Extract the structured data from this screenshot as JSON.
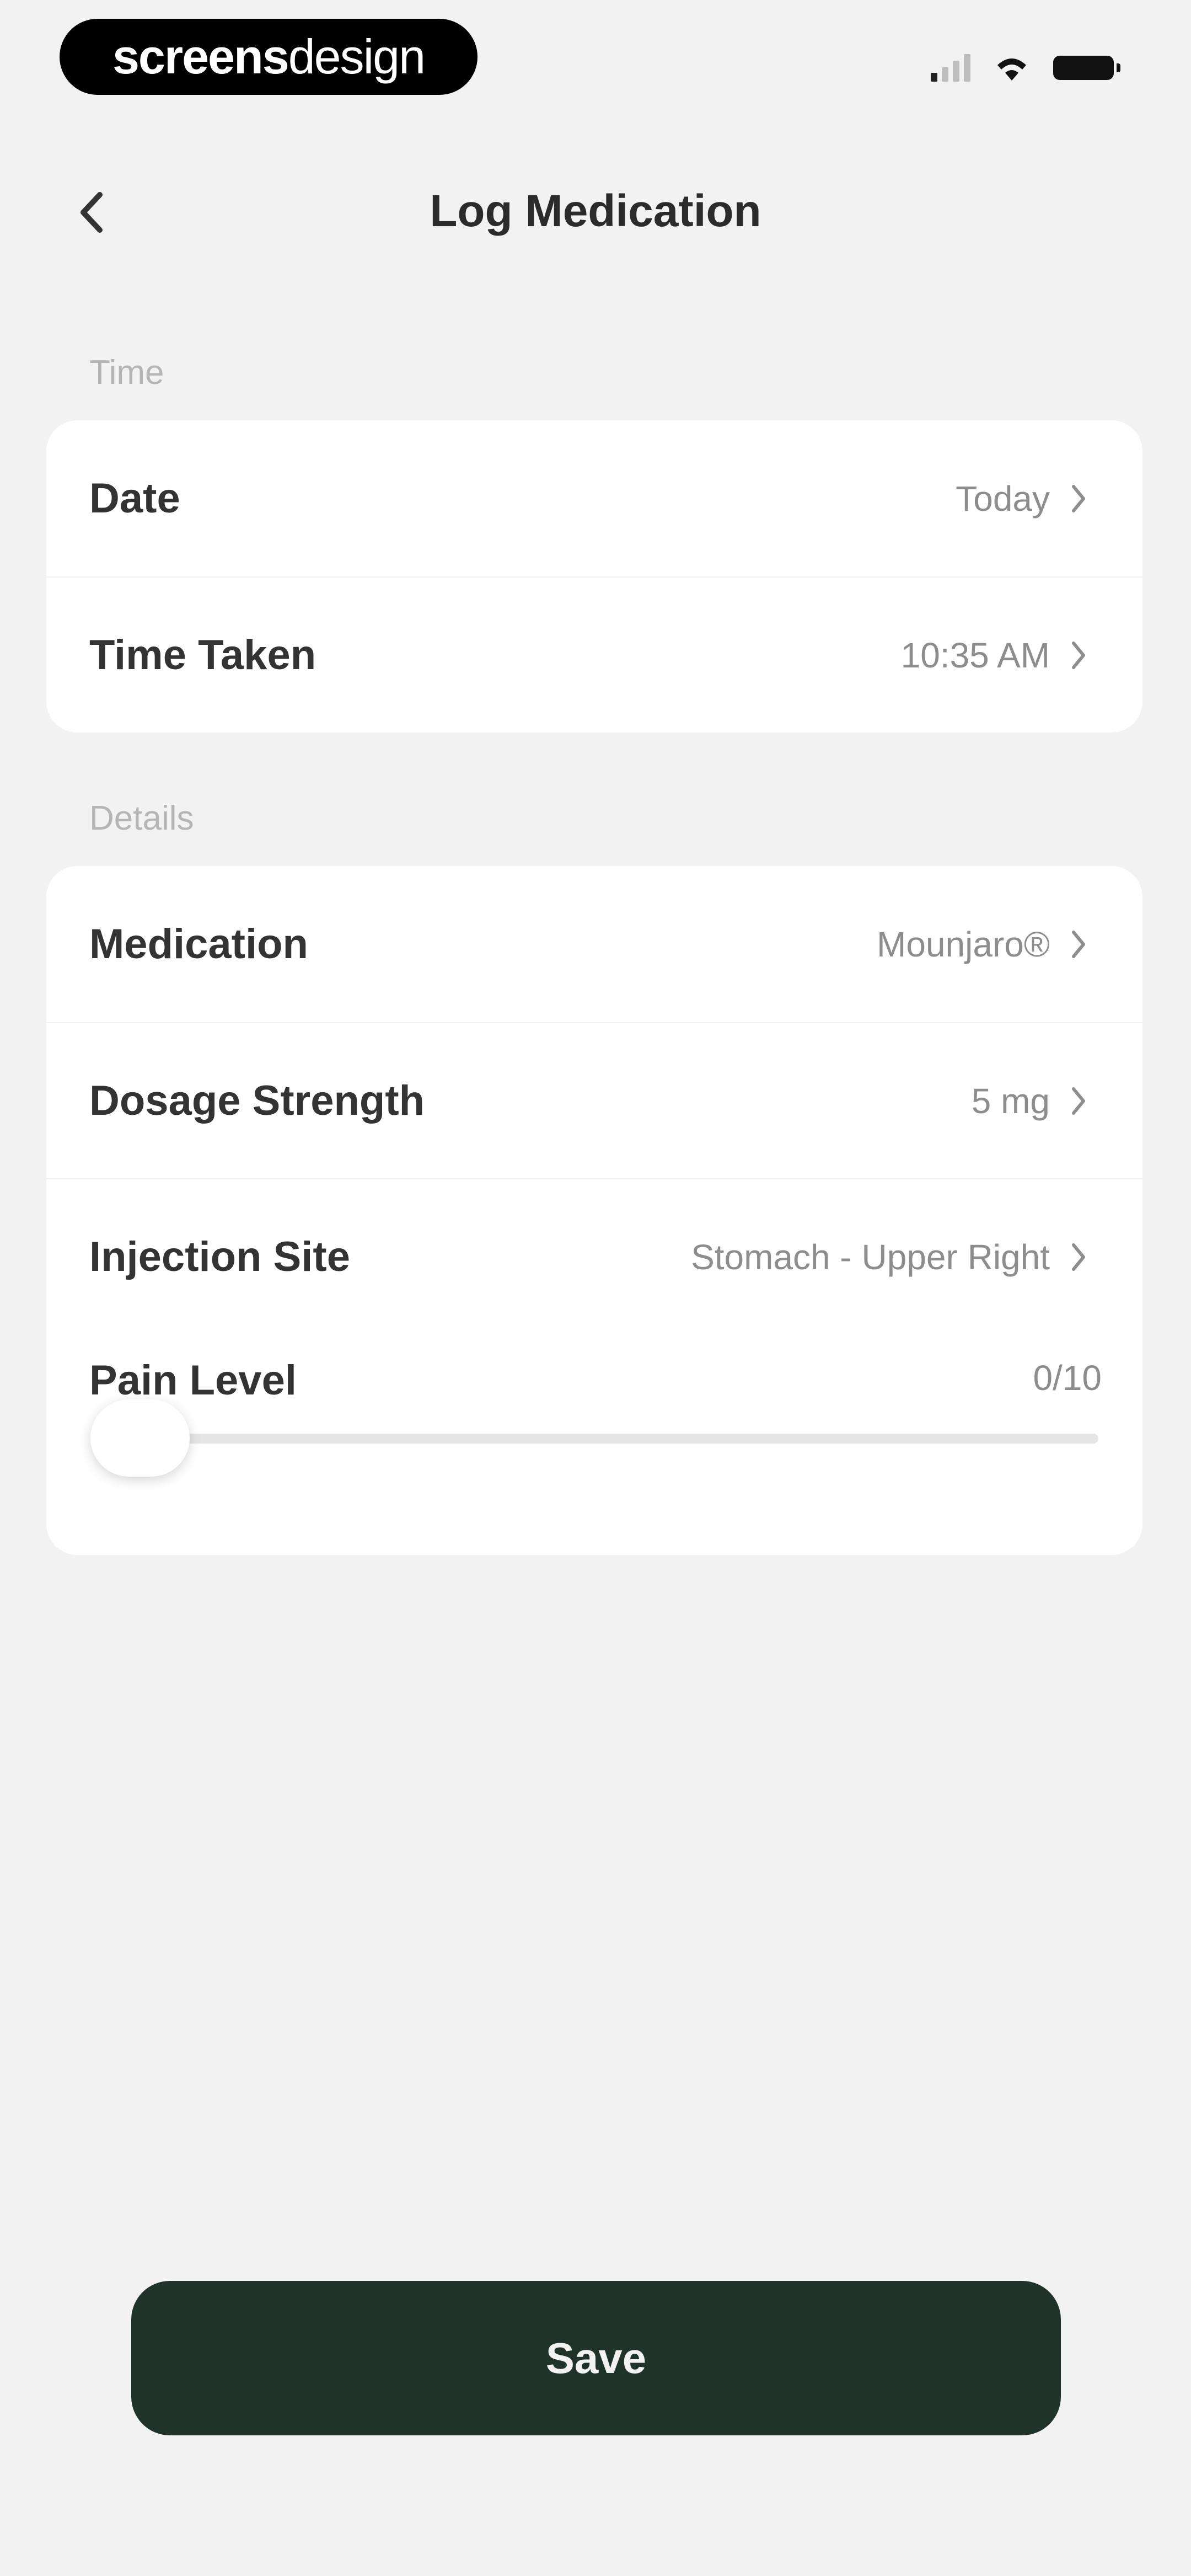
{
  "status_bar": {
    "brand_bold": "screens",
    "brand_light": "design"
  },
  "header": {
    "title": "Log Medication",
    "back_icon": "chevron-left-icon"
  },
  "time_section": {
    "label": "Time",
    "rows": [
      {
        "label": "Date",
        "value": "Today"
      },
      {
        "label": "Time Taken",
        "value": "10:35 AM"
      }
    ]
  },
  "details_section": {
    "label": "Details",
    "rows": [
      {
        "label": "Medication",
        "value": "Mounjaro®"
      },
      {
        "label": "Dosage Strength",
        "value": "5 mg"
      },
      {
        "label": "Injection Site",
        "value": "Stomach - Upper Right"
      }
    ],
    "pain_level": {
      "label": "Pain Level",
      "display": "0/10",
      "value": 0,
      "max": 10
    }
  },
  "footer": {
    "save_label": "Save"
  },
  "colors": {
    "background": "#f2f2f2",
    "card": "#ffffff",
    "primary_button": "#20332b"
  }
}
